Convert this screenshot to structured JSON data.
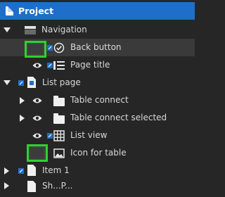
{
  "header": {
    "title": "Project",
    "icon": "page-icon"
  },
  "rows": [
    {
      "label": "Navigation",
      "icon": "navigation-bar-icon"
    },
    {
      "label": "Back button",
      "icon": "check-circle-icon"
    },
    {
      "label": "Page title",
      "icon": "text-lines-icon"
    },
    {
      "label": "List page",
      "icon": "page-icon"
    },
    {
      "label": "Table connect",
      "icon": "folder-icon"
    },
    {
      "label": "Table connect selected",
      "icon": "folder-icon"
    },
    {
      "label": "List view",
      "icon": "grid-icon"
    },
    {
      "label": "Icon for table",
      "icon": "image-icon"
    },
    {
      "label": "Item 1",
      "icon": "page-icon"
    },
    {
      "label": "Sh...P...",
      "icon": "page-icon"
    }
  ],
  "colors": {
    "header_bg": "#1e6fc9",
    "panel_bg": "#262626",
    "highlight": "#2ed12e",
    "link_blue": "#1e6fc9"
  }
}
